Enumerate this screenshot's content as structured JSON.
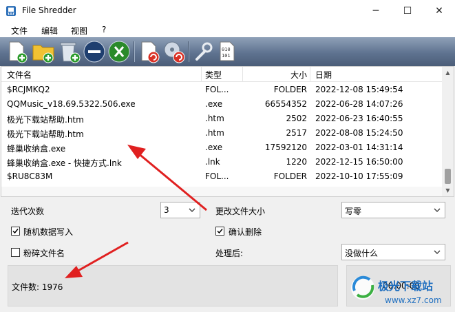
{
  "window": {
    "title": "File Shredder"
  },
  "titlebar": {
    "minimize": "─",
    "maximize": "☐",
    "close": "✕"
  },
  "menu": {
    "items": [
      "文件",
      "编辑",
      "视图",
      "?"
    ]
  },
  "toolbar": {
    "buttons": [
      "add-file",
      "add-folder",
      "add-recycle-bin",
      "remove",
      "clear",
      "shred",
      "shred-drive",
      "settings",
      "binary"
    ]
  },
  "list": {
    "columns": [
      "文件名",
      "类型",
      "大小",
      "日期"
    ],
    "rows": [
      {
        "name": "$RCJMKQ2",
        "type": "FOL...",
        "size": "FOLDER",
        "date": "2022-12-08 15:49:54"
      },
      {
        "name": "QQMusic_v18.69.5322.506.exe",
        "type": ".exe",
        "size": "66554352",
        "date": "2022-06-28 14:07:26"
      },
      {
        "name": "极光下载站帮助.htm",
        "type": ".htm",
        "size": "2502",
        "date": "2022-06-23 16:40:55"
      },
      {
        "name": "极光下载站帮助.htm",
        "type": ".htm",
        "size": "2517",
        "date": "2022-08-08 15:24:50"
      },
      {
        "name": "蜂巢收纳盒.exe",
        "type": ".exe",
        "size": "17592120",
        "date": "2022-03-01 14:31:14"
      },
      {
        "name": "蜂巢收纳盒.exe - 快捷方式.lnk",
        "type": ".lnk",
        "size": "1220",
        "date": "2022-12-15 16:50:00"
      },
      {
        "name": "$RU8C83M",
        "type": "FOL...",
        "size": "FOLDER",
        "date": "2022-10-10 17:55:09"
      }
    ]
  },
  "options": {
    "iterations_label": "迭代次数",
    "iterations_value": "3",
    "change_size_label": "更改文件大小",
    "change_size_value": "写零",
    "random_data_label": "随机数据写入",
    "random_data_checked": true,
    "confirm_delete_label": "确认删除",
    "confirm_delete_checked": true,
    "shred_name_label": "粉碎文件名",
    "shred_name_checked": false,
    "after_label": "处理后:",
    "after_value": "没做什么"
  },
  "status": {
    "file_count": "文件数: 1976",
    "timer": "00:00:00"
  },
  "watermark": {
    "brand": "极光下载站",
    "url": "www.xz7.com"
  },
  "colors": {
    "annotation": "#e02020",
    "toolbar": "#5f7390"
  }
}
